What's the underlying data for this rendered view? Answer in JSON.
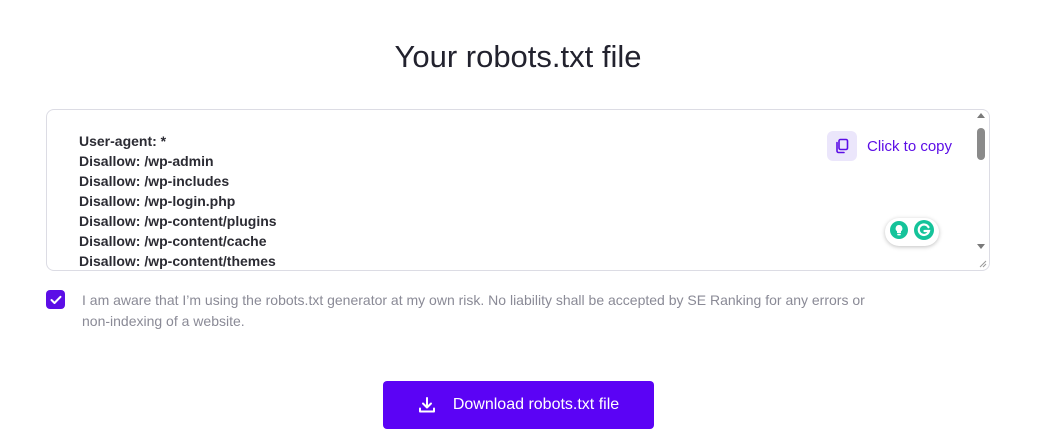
{
  "page": {
    "title": "Your robots.txt file"
  },
  "editor": {
    "lines": [
      "User-agent: *",
      "Disallow: /wp-admin",
      "Disallow: /wp-includes",
      "Disallow: /wp-login.php",
      "Disallow: /wp-content/plugins",
      "Disallow: /wp-content/cache",
      "Disallow: /wp-content/themes"
    ],
    "copy_label": "Click to copy"
  },
  "consent": {
    "checked": true,
    "text": "I am aware that I’m using the robots.txt generator at my own risk. No liability shall be accepted by SE Ranking for any errors or non-indexing of a website."
  },
  "download": {
    "label": "Download robots.txt file"
  },
  "colors": {
    "accent": "#5c0ee6",
    "button": "#5b03f5",
    "grammarly": "#15c39a"
  },
  "icons": [
    "copy-icon",
    "download-icon",
    "checkmark-icon",
    "grammarly-icon",
    "lightbulb-icon"
  ]
}
